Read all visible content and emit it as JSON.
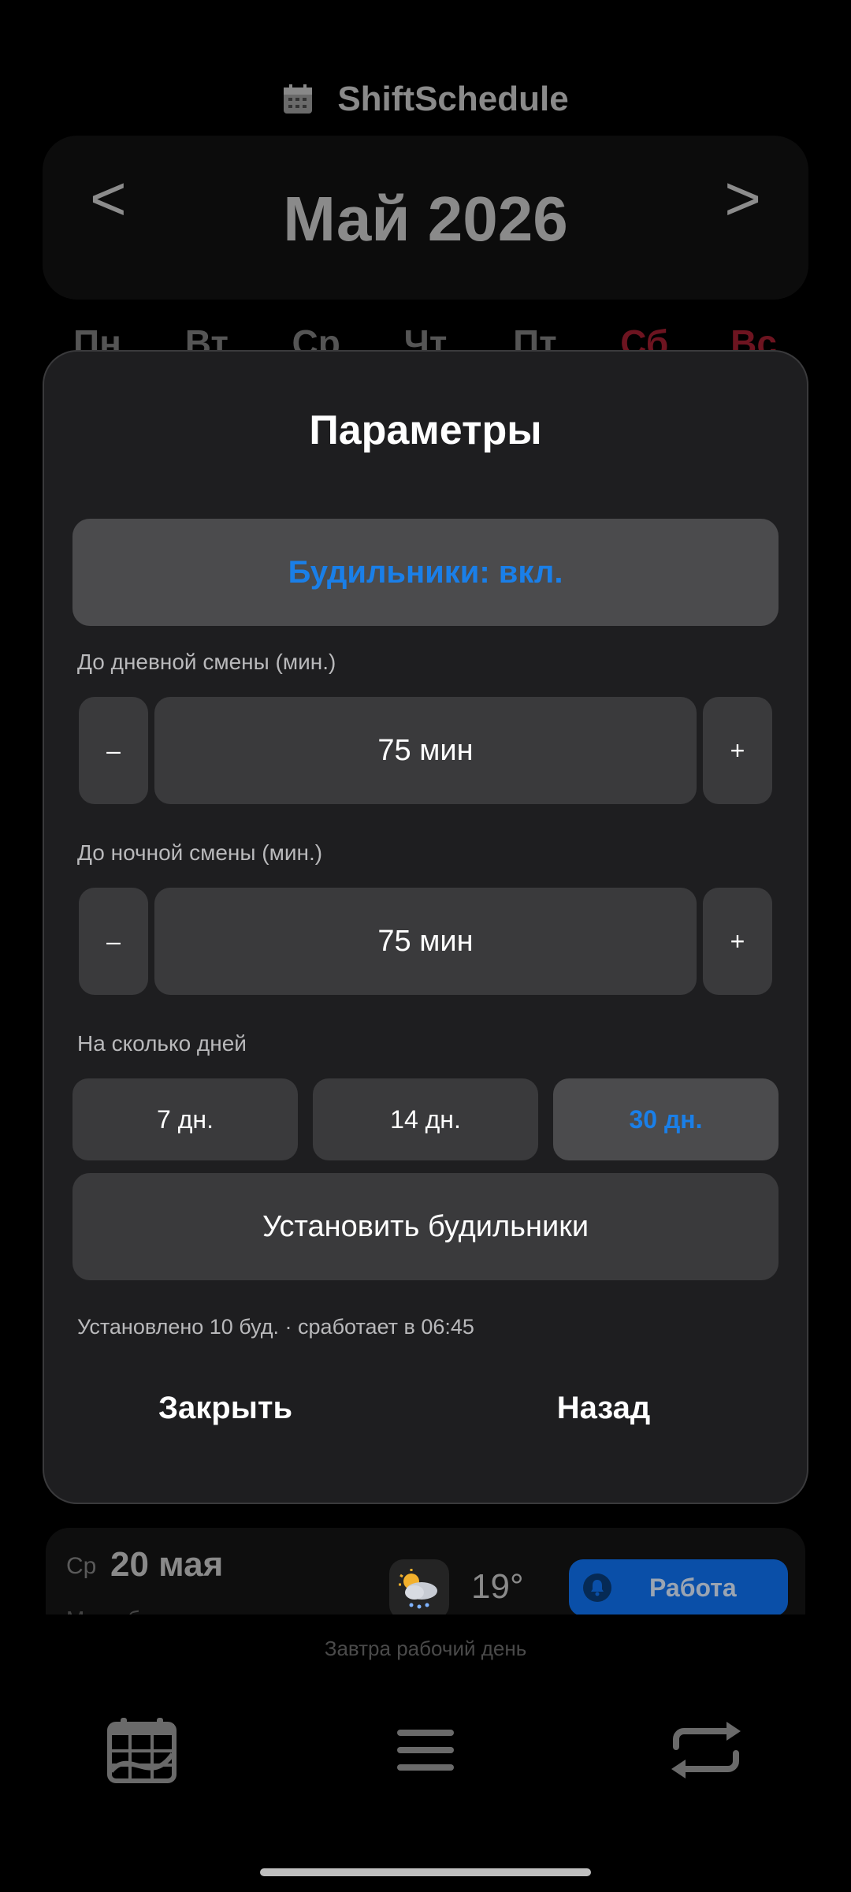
{
  "app": {
    "title": "ShiftSchedule",
    "month_label": "Май 2026",
    "prev": "<",
    "next": ">"
  },
  "weekdays": [
    "Пн",
    "Вт",
    "Ср",
    "Чт",
    "Пт",
    "Сб",
    "Вс"
  ],
  "day_card": {
    "dow": "Ср",
    "date": "20 мая",
    "subtitle": "М... ...б...",
    "temperature": "19°",
    "weather_icon": "cloudy-snow-icon",
    "shift_label": "Работа"
  },
  "tomorrow_text": "Завтра рабочий день",
  "nav": {
    "items": [
      "calendar-icon",
      "menu-icon",
      "sync-icon"
    ]
  },
  "modal": {
    "title": "Параметры",
    "alarms_toggle": "Будильники: вкл.",
    "day_shift": {
      "label": "До дневной смены (мин.)",
      "minus": "–",
      "value": "75 мин",
      "plus": "+"
    },
    "night_shift": {
      "label": "До ночной смены (мин.)",
      "minus": "–",
      "value": "75 мин",
      "plus": "+"
    },
    "days": {
      "label": "На сколько дней",
      "options": [
        "7 дн.",
        "14 дн.",
        "30 дн."
      ],
      "selected": "30 дн."
    },
    "set_button": "Установить будильники",
    "status": "Установлено 10 буд. · сработает в 06:45",
    "close": "Закрыть",
    "back": "Назад"
  },
  "colors": {
    "accent": "#1a7fe8",
    "modal_bg": "#1e1e20",
    "button_bg": "#3a3a3c",
    "weekend": "#6d1420",
    "work": "#0a4fa8"
  }
}
